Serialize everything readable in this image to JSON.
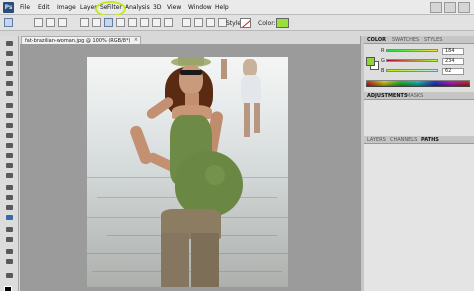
{
  "app": {
    "logo": "Ps"
  },
  "menu": {
    "items": [
      "File",
      "Edit",
      "Image",
      "Layer",
      "Select",
      "Filter",
      "Analysis",
      "3D",
      "View",
      "Window",
      "Help"
    ],
    "highlighted": "Filter"
  },
  "options": {
    "style_label": "Style:",
    "color_label": "Color:",
    "color_value": "#9ae03a"
  },
  "document": {
    "tab_title": "fat-brazilian-woman.jpg @ 100% (RGB/8*)",
    "close_glyph": "×"
  },
  "panels": {
    "group1_tabs": [
      "COLOR",
      "SWATCHES",
      "STYLES"
    ],
    "color": {
      "foreground": "#8fd43a",
      "sliders": [
        {
          "label": "R",
          "value": "184"
        },
        {
          "label": "G",
          "value": "234"
        },
        {
          "label": "B",
          "value": "62"
        }
      ]
    },
    "group2_tabs": [
      "ADJUSTMENTS",
      "MASKS"
    ],
    "group3_tabs": [
      "LAYERS",
      "CHANNELS",
      "PATHS"
    ]
  },
  "icons": [
    "photoshop-logo-icon",
    "marquee-tool-icon",
    "lasso-tool-icon",
    "brush-tool-icon",
    "eraser-tool-icon",
    "type-tool-icon",
    "zoom-tool-icon"
  ]
}
